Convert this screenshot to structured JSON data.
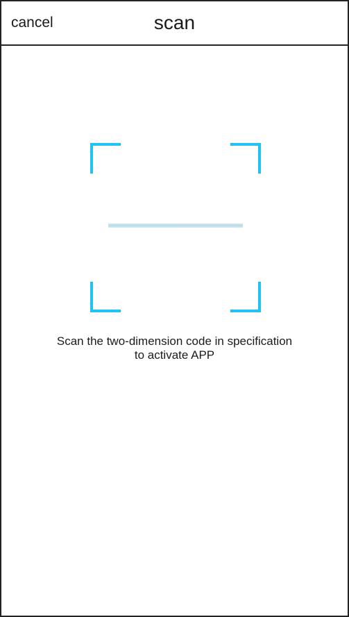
{
  "header": {
    "cancel_label": "cancel",
    "title": "scan"
  },
  "scanner": {
    "frame_color": "#1ec3f2",
    "scan_line_color": "#b9dbe8",
    "instruction_line1": "Scan the two-dimension code in specification",
    "instruction_line2": "to activate APP"
  }
}
